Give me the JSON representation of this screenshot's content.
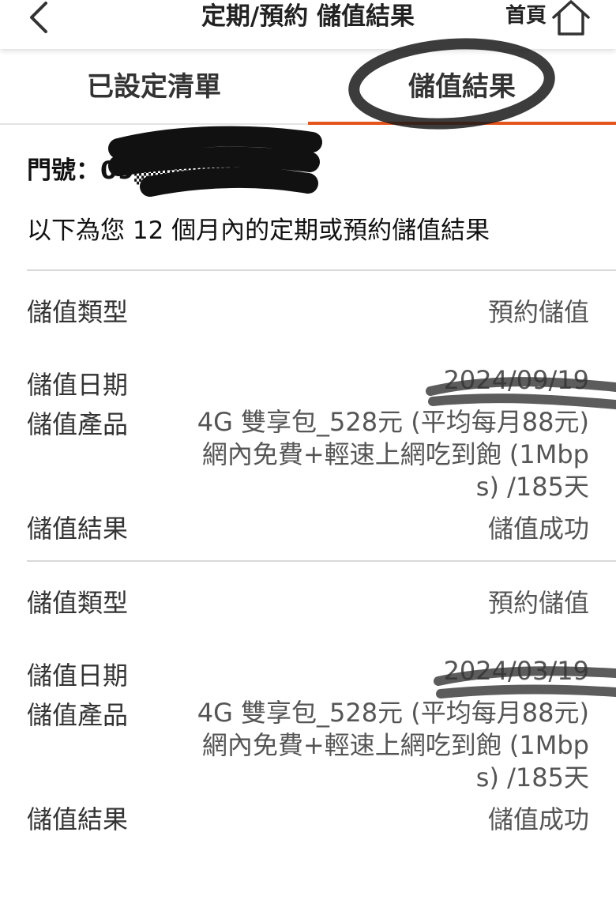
{
  "header": {
    "title": "定期/預約 儲值結果",
    "home_label": "首頁"
  },
  "tabs": [
    {
      "label": "已設定清單",
      "active": false
    },
    {
      "label": "儲值結果",
      "active": true
    }
  ],
  "account": {
    "label": "門號：",
    "number_visible": "09▒▒▒▒▒08"
  },
  "notice": "以下為您 12 個月內的定期或預約儲值結果",
  "records": [
    {
      "type_label": "儲值類型",
      "type_value": "預約儲值",
      "date_label": "儲值日期",
      "date_value": "2024/09/19",
      "product_label": "儲值產品",
      "product_lines": [
        "4G 雙享包_528元 (平均每月88元)",
        "網內免費+輕速上網吃到飽 (1Mbp",
        "s) /185天"
      ],
      "result_label": "儲值結果",
      "result_value": "儲值成功"
    },
    {
      "type_label": "儲值類型",
      "type_value": "預約儲值",
      "date_label": "儲值日期",
      "date_value": "2024/03/19",
      "product_label": "儲值產品",
      "product_lines": [
        "4G 雙享包_528元 (平均每月88元)",
        "網內免費+輕速上網吃到飽 (1Mbp",
        "s) /185天"
      ],
      "result_label": "儲值結果",
      "result_value": "儲值成功"
    }
  ],
  "colors": {
    "accent": "#e4551d",
    "divider": "#d8d8d8"
  }
}
